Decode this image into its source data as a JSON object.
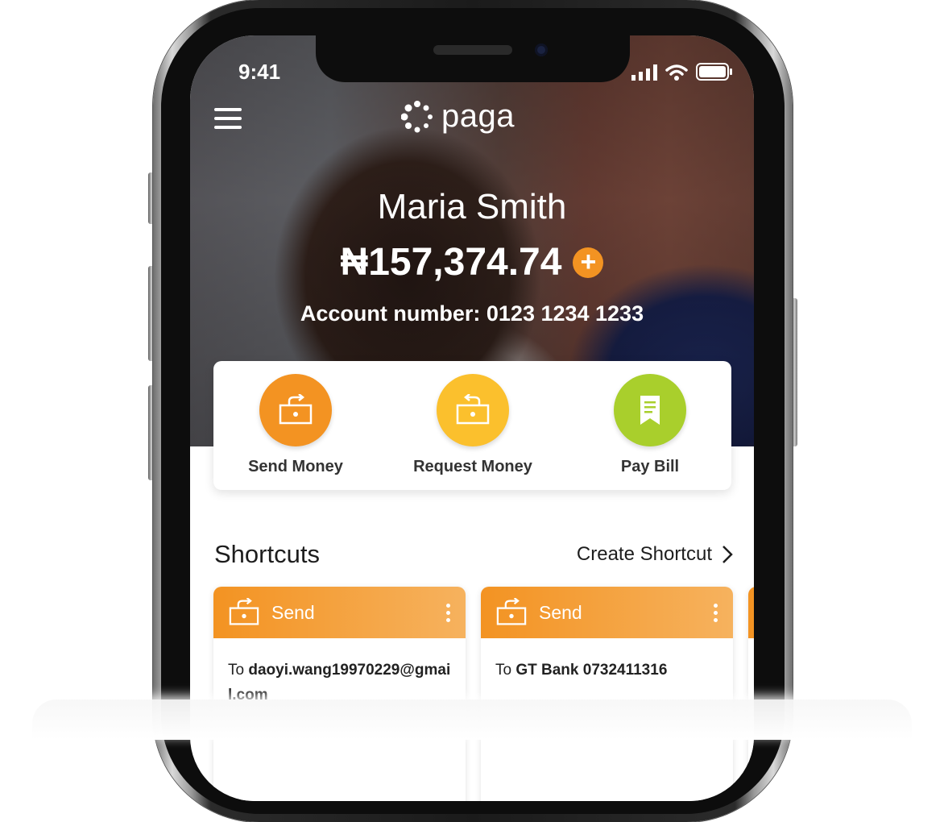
{
  "status_bar": {
    "time": "9:41"
  },
  "header": {
    "logo_text": "paga"
  },
  "account": {
    "name": "Maria Smith",
    "balance": "₦157,374.74",
    "add_symbol": "+",
    "account_number": "Account number: 0123 1234 1233"
  },
  "actions": [
    {
      "label": "Send Money",
      "color": "#f39322"
    },
    {
      "label": "Request Money",
      "color": "#fbc02d"
    },
    {
      "label": "Pay Bill",
      "color": "#a9cf2c"
    }
  ],
  "shortcuts": {
    "title": "Shortcuts",
    "create_label": "Create Shortcut",
    "cards": [
      {
        "type": "Send",
        "prefix": "To ",
        "recipient": "daoyi.wang19970229@gmail.com"
      },
      {
        "type": "Send",
        "prefix": "To ",
        "recipient": "GT Bank 0732411316"
      }
    ]
  },
  "colors": {
    "brand_orange": "#f39322",
    "request_yellow": "#fbc02d",
    "bill_green": "#a9cf2c"
  }
}
